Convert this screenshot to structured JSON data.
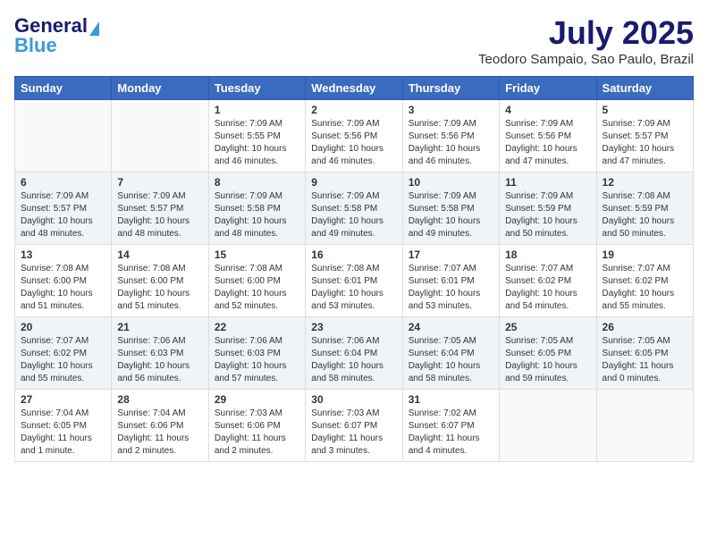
{
  "header": {
    "logo_line1": "General",
    "logo_line2": "Blue",
    "title": "July 2025",
    "subtitle": "Teodoro Sampaio, Sao Paulo, Brazil"
  },
  "weekdays": [
    "Sunday",
    "Monday",
    "Tuesday",
    "Wednesday",
    "Thursday",
    "Friday",
    "Saturday"
  ],
  "weeks": [
    [
      {
        "day": "",
        "sunrise": "",
        "sunset": "",
        "daylight": ""
      },
      {
        "day": "",
        "sunrise": "",
        "sunset": "",
        "daylight": ""
      },
      {
        "day": "1",
        "sunrise": "Sunrise: 7:09 AM",
        "sunset": "Sunset: 5:55 PM",
        "daylight": "Daylight: 10 hours and 46 minutes."
      },
      {
        "day": "2",
        "sunrise": "Sunrise: 7:09 AM",
        "sunset": "Sunset: 5:56 PM",
        "daylight": "Daylight: 10 hours and 46 minutes."
      },
      {
        "day": "3",
        "sunrise": "Sunrise: 7:09 AM",
        "sunset": "Sunset: 5:56 PM",
        "daylight": "Daylight: 10 hours and 46 minutes."
      },
      {
        "day": "4",
        "sunrise": "Sunrise: 7:09 AM",
        "sunset": "Sunset: 5:56 PM",
        "daylight": "Daylight: 10 hours and 47 minutes."
      },
      {
        "day": "5",
        "sunrise": "Sunrise: 7:09 AM",
        "sunset": "Sunset: 5:57 PM",
        "daylight": "Daylight: 10 hours and 47 minutes."
      }
    ],
    [
      {
        "day": "6",
        "sunrise": "Sunrise: 7:09 AM",
        "sunset": "Sunset: 5:57 PM",
        "daylight": "Daylight: 10 hours and 48 minutes."
      },
      {
        "day": "7",
        "sunrise": "Sunrise: 7:09 AM",
        "sunset": "Sunset: 5:57 PM",
        "daylight": "Daylight: 10 hours and 48 minutes."
      },
      {
        "day": "8",
        "sunrise": "Sunrise: 7:09 AM",
        "sunset": "Sunset: 5:58 PM",
        "daylight": "Daylight: 10 hours and 48 minutes."
      },
      {
        "day": "9",
        "sunrise": "Sunrise: 7:09 AM",
        "sunset": "Sunset: 5:58 PM",
        "daylight": "Daylight: 10 hours and 49 minutes."
      },
      {
        "day": "10",
        "sunrise": "Sunrise: 7:09 AM",
        "sunset": "Sunset: 5:58 PM",
        "daylight": "Daylight: 10 hours and 49 minutes."
      },
      {
        "day": "11",
        "sunrise": "Sunrise: 7:09 AM",
        "sunset": "Sunset: 5:59 PM",
        "daylight": "Daylight: 10 hours and 50 minutes."
      },
      {
        "day": "12",
        "sunrise": "Sunrise: 7:08 AM",
        "sunset": "Sunset: 5:59 PM",
        "daylight": "Daylight: 10 hours and 50 minutes."
      }
    ],
    [
      {
        "day": "13",
        "sunrise": "Sunrise: 7:08 AM",
        "sunset": "Sunset: 6:00 PM",
        "daylight": "Daylight: 10 hours and 51 minutes."
      },
      {
        "day": "14",
        "sunrise": "Sunrise: 7:08 AM",
        "sunset": "Sunset: 6:00 PM",
        "daylight": "Daylight: 10 hours and 51 minutes."
      },
      {
        "day": "15",
        "sunrise": "Sunrise: 7:08 AM",
        "sunset": "Sunset: 6:00 PM",
        "daylight": "Daylight: 10 hours and 52 minutes."
      },
      {
        "day": "16",
        "sunrise": "Sunrise: 7:08 AM",
        "sunset": "Sunset: 6:01 PM",
        "daylight": "Daylight: 10 hours and 53 minutes."
      },
      {
        "day": "17",
        "sunrise": "Sunrise: 7:07 AM",
        "sunset": "Sunset: 6:01 PM",
        "daylight": "Daylight: 10 hours and 53 minutes."
      },
      {
        "day": "18",
        "sunrise": "Sunrise: 7:07 AM",
        "sunset": "Sunset: 6:02 PM",
        "daylight": "Daylight: 10 hours and 54 minutes."
      },
      {
        "day": "19",
        "sunrise": "Sunrise: 7:07 AM",
        "sunset": "Sunset: 6:02 PM",
        "daylight": "Daylight: 10 hours and 55 minutes."
      }
    ],
    [
      {
        "day": "20",
        "sunrise": "Sunrise: 7:07 AM",
        "sunset": "Sunset: 6:02 PM",
        "daylight": "Daylight: 10 hours and 55 minutes."
      },
      {
        "day": "21",
        "sunrise": "Sunrise: 7:06 AM",
        "sunset": "Sunset: 6:03 PM",
        "daylight": "Daylight: 10 hours and 56 minutes."
      },
      {
        "day": "22",
        "sunrise": "Sunrise: 7:06 AM",
        "sunset": "Sunset: 6:03 PM",
        "daylight": "Daylight: 10 hours and 57 minutes."
      },
      {
        "day": "23",
        "sunrise": "Sunrise: 7:06 AM",
        "sunset": "Sunset: 6:04 PM",
        "daylight": "Daylight: 10 hours and 58 minutes."
      },
      {
        "day": "24",
        "sunrise": "Sunrise: 7:05 AM",
        "sunset": "Sunset: 6:04 PM",
        "daylight": "Daylight: 10 hours and 58 minutes."
      },
      {
        "day": "25",
        "sunrise": "Sunrise: 7:05 AM",
        "sunset": "Sunset: 6:05 PM",
        "daylight": "Daylight: 10 hours and 59 minutes."
      },
      {
        "day": "26",
        "sunrise": "Sunrise: 7:05 AM",
        "sunset": "Sunset: 6:05 PM",
        "daylight": "Daylight: 11 hours and 0 minutes."
      }
    ],
    [
      {
        "day": "27",
        "sunrise": "Sunrise: 7:04 AM",
        "sunset": "Sunset: 6:05 PM",
        "daylight": "Daylight: 11 hours and 1 minute."
      },
      {
        "day": "28",
        "sunrise": "Sunrise: 7:04 AM",
        "sunset": "Sunset: 6:06 PM",
        "daylight": "Daylight: 11 hours and 2 minutes."
      },
      {
        "day": "29",
        "sunrise": "Sunrise: 7:03 AM",
        "sunset": "Sunset: 6:06 PM",
        "daylight": "Daylight: 11 hours and 2 minutes."
      },
      {
        "day": "30",
        "sunrise": "Sunrise: 7:03 AM",
        "sunset": "Sunset: 6:07 PM",
        "daylight": "Daylight: 11 hours and 3 minutes."
      },
      {
        "day": "31",
        "sunrise": "Sunrise: 7:02 AM",
        "sunset": "Sunset: 6:07 PM",
        "daylight": "Daylight: 11 hours and 4 minutes."
      },
      {
        "day": "",
        "sunrise": "",
        "sunset": "",
        "daylight": ""
      },
      {
        "day": "",
        "sunrise": "",
        "sunset": "",
        "daylight": ""
      }
    ]
  ]
}
